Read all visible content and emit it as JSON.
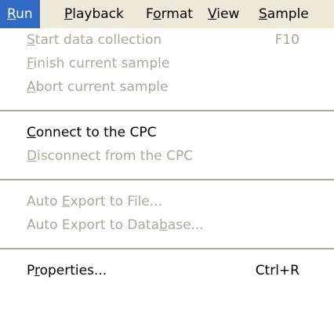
{
  "menubar": {
    "items": [
      {
        "key": "R",
        "rest": "un",
        "active": true
      },
      {
        "key": "P",
        "rest": "layback",
        "active": false
      },
      {
        "pre": "F",
        "key": "o",
        "rest": "rmat",
        "active": false
      },
      {
        "key": "V",
        "rest": "iew",
        "active": false
      },
      {
        "key": "S",
        "rest": "ample",
        "active": false
      }
    ]
  },
  "run_menu": {
    "items": [
      {
        "key": "S",
        "rest": "tart data collection",
        "shortcut": "F10",
        "enabled": false
      },
      {
        "key": "F",
        "rest": "inish current sample",
        "enabled": false
      },
      {
        "key": "A",
        "rest": "bort current sample",
        "enabled": false
      },
      {
        "key": "C",
        "rest": "onnect to the CPC",
        "enabled": true
      },
      {
        "key": "D",
        "rest": "isconnect from the CPC",
        "enabled": false
      },
      {
        "pre": "Auto ",
        "key": "E",
        "rest": "xport to File...",
        "enabled": false
      },
      {
        "pre": "Auto Export to Data",
        "key": "b",
        "rest": "ase...",
        "enabled": false
      },
      {
        "pre": "P",
        "key": "r",
        "rest": "operties...",
        "shortcut": "Ctrl+R",
        "enabled": true
      }
    ]
  }
}
